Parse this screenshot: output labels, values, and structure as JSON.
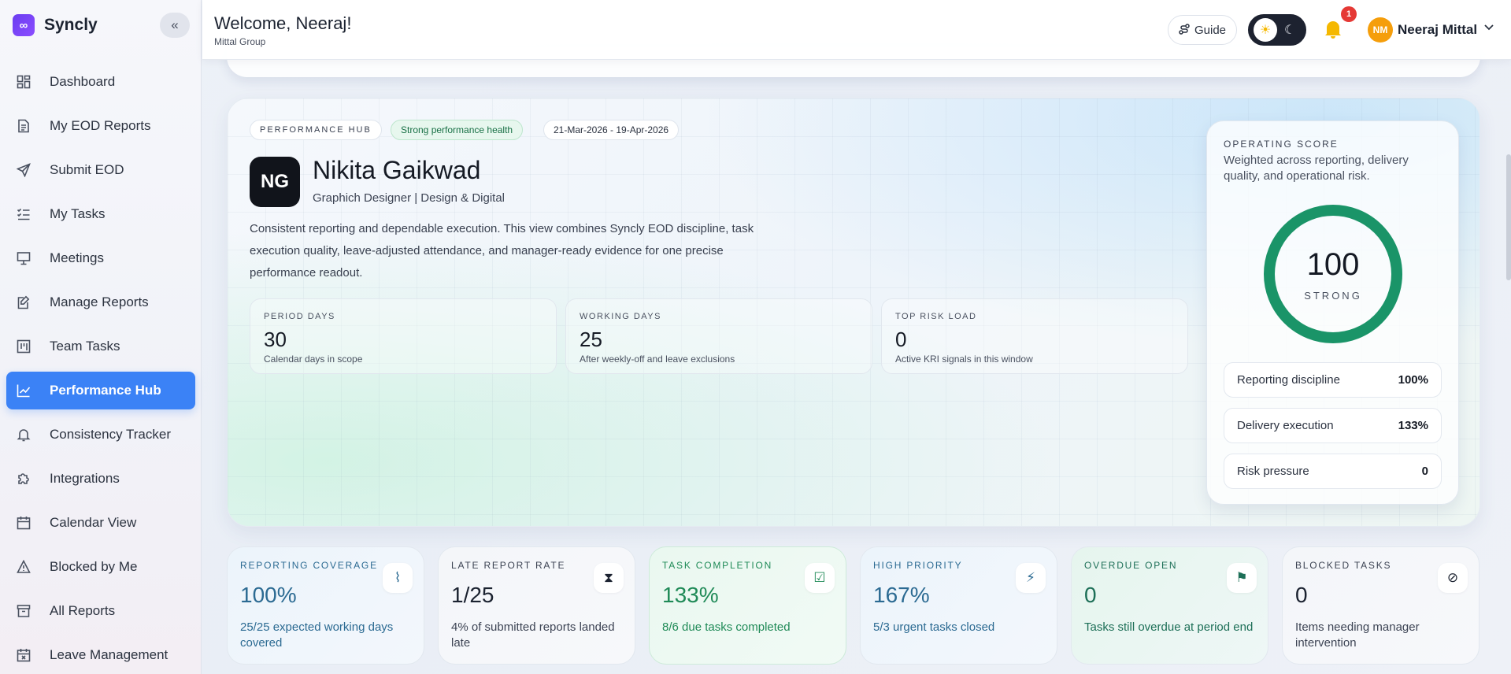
{
  "app": {
    "name": "Syncly",
    "logo_glyph": "∞",
    "collapse_glyph": "«"
  },
  "sidebar": {
    "items": [
      {
        "label": "Dashboard",
        "icon": "dashboard-icon"
      },
      {
        "label": "My EOD Reports",
        "icon": "report-icon"
      },
      {
        "label": "Submit EOD",
        "icon": "send-icon"
      },
      {
        "label": "My Tasks",
        "icon": "task-list-icon"
      },
      {
        "label": "Meetings",
        "icon": "presentation-icon"
      },
      {
        "label": "Manage Reports",
        "icon": "edit-report-icon"
      },
      {
        "label": "Team Tasks",
        "icon": "kanban-icon"
      },
      {
        "label": "Performance Hub",
        "icon": "chart-line-icon",
        "active": true
      },
      {
        "label": "Consistency Tracker",
        "icon": "bell-icon"
      },
      {
        "label": "Integrations",
        "icon": "puzzle-icon"
      },
      {
        "label": "Calendar View",
        "icon": "calendar-icon"
      },
      {
        "label": "Blocked by Me",
        "icon": "warning-icon"
      },
      {
        "label": "All Reports",
        "icon": "archive-icon"
      },
      {
        "label": "Leave Management",
        "icon": "calendar-x-icon"
      }
    ]
  },
  "header": {
    "welcome": "Welcome, Neeraj!",
    "org": "Mittal Group",
    "guide_label": "Guide",
    "notification_count": "1",
    "user_initials": "NM",
    "user_name": "Neeraj Mittal"
  },
  "hero": {
    "tag": "PERFORMANCE HUB",
    "health": "Strong performance health",
    "range": "21-Mar-2026 - 19-Apr-2026",
    "initials": "NG",
    "name": "Nikita Gaikwad",
    "role": "Graphich Designer | Design & Digital",
    "description": "Consistent reporting and dependable execution. This view combines Syncly EOD discipline, task execution quality, leave-adjusted attendance, and manager-ready evidence for one precise performance readout.",
    "stats": [
      {
        "label": "PERIOD DAYS",
        "value": "30",
        "sub": "Calendar days in scope"
      },
      {
        "label": "WORKING DAYS",
        "value": "25",
        "sub": "After weekly-off and leave exclusions"
      },
      {
        "label": "TOP RISK LOAD",
        "value": "0",
        "sub": "Active KRI signals in this window"
      }
    ]
  },
  "score": {
    "title": "OPERATING SCORE",
    "desc": "Weighted across reporting, delivery quality, and operational risk.",
    "value": "100",
    "level": "STRONG",
    "progress": 1.0,
    "ring_color": "#1a9468",
    "metrics": [
      {
        "label": "Reporting discipline",
        "value": "100%"
      },
      {
        "label": "Delivery execution",
        "value": "133%"
      },
      {
        "label": "Risk pressure",
        "value": "0"
      }
    ]
  },
  "kpis": [
    {
      "label": "REPORTING COVERAGE",
      "value": "100%",
      "sub": "25/25 expected working days covered",
      "icon": "pulse-icon",
      "glyph": "⌇",
      "tone": "blue"
    },
    {
      "label": "LATE REPORT RATE",
      "value": "1/25",
      "sub": "4% of submitted reports landed late",
      "icon": "hourglass-icon",
      "glyph": "⧗",
      "tone": "gray"
    },
    {
      "label": "TASK COMPLETION",
      "value": "133%",
      "sub": "8/6 due tasks completed",
      "icon": "checklist-icon",
      "glyph": "☑",
      "tone": "green"
    },
    {
      "label": "HIGH PRIORITY",
      "value": "167%",
      "sub": "5/3 urgent tasks closed",
      "icon": "lightning-icon",
      "glyph": "⚡",
      "tone": "blue"
    },
    {
      "label": "OVERDUE OPEN",
      "value": "0",
      "sub": "Tasks still overdue at period end",
      "icon": "flag-icon",
      "glyph": "⚑",
      "tone": "teal"
    },
    {
      "label": "BLOCKED TASKS",
      "value": "0",
      "sub": "Items needing manager intervention",
      "icon": "blocked-icon",
      "glyph": "⊘",
      "tone": "gray"
    }
  ]
}
